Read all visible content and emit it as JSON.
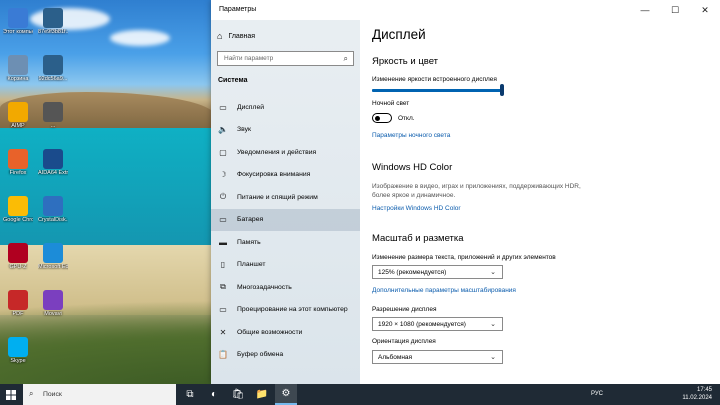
{
  "desktop": {
    "icons": [
      {
        "label": "Этот компьютер",
        "icon": "computer-icon",
        "color": "#3a7bd5"
      },
      {
        "label": "87e9f3b81f...",
        "icon": "image-file-icon",
        "color": "#2b5f8a"
      },
      {
        "label": "Корзина",
        "icon": "recycle-bin-icon",
        "color": "#6d8fb3"
      },
      {
        "label": "92dc56a9...",
        "icon": "image-file-icon",
        "color": "#2b5f8a"
      },
      {
        "label": "AIMP",
        "icon": "aimp-icon",
        "color": "#f2a900"
      },
      {
        "label": "...",
        "icon": "image-file-icon",
        "color": "#555"
      },
      {
        "label": "Firefox",
        "icon": "firefox-icon",
        "color": "#e8622a"
      },
      {
        "label": "AIDA64 Extreme",
        "icon": "aida64-icon",
        "color": "#1a4b8c"
      },
      {
        "label": "Google Chrome",
        "icon": "chrome-icon",
        "color": "#fbbc05"
      },
      {
        "label": "CrystalDisk...",
        "icon": "crystaldisk-icon",
        "color": "#2e6fbf"
      },
      {
        "label": "GPU-Z",
        "icon": "gpuz-icon",
        "color": "#b00020"
      },
      {
        "label": "Microsoft Edge",
        "icon": "edge-icon",
        "color": "#1c8cd8"
      },
      {
        "label": "PDF",
        "icon": "pdf-icon",
        "color": "#c62828"
      },
      {
        "label": "Movavi",
        "icon": "movavi-icon",
        "color": "#7b3fbf"
      },
      {
        "label": "Skype",
        "icon": "skype-icon",
        "color": "#00aff0"
      }
    ]
  },
  "window": {
    "title": "Параметры",
    "minimize": "—",
    "maximize": "☐",
    "close": "✕"
  },
  "sidebar": {
    "home": "Главная",
    "search_placeholder": "Найти параметр",
    "section": "Система",
    "items": [
      {
        "label": "Дисплей",
        "icon": "display-icon",
        "glyph": "▭"
      },
      {
        "label": "Звук",
        "icon": "speaker-icon",
        "glyph": "🔈"
      },
      {
        "label": "Уведомления и действия",
        "icon": "notification-icon",
        "glyph": "▢"
      },
      {
        "label": "Фокусировка внимания",
        "icon": "focus-moon-icon",
        "glyph": "☽"
      },
      {
        "label": "Питание и спящий режим",
        "icon": "power-icon",
        "glyph": "⏻"
      },
      {
        "label": "Батарея",
        "icon": "battery-icon",
        "glyph": "▭"
      },
      {
        "label": "Память",
        "icon": "storage-icon",
        "glyph": "▬"
      },
      {
        "label": "Планшет",
        "icon": "tablet-icon",
        "glyph": "▯"
      },
      {
        "label": "Многозадачность",
        "icon": "multitasking-icon",
        "glyph": "⧉"
      },
      {
        "label": "Проецирование на этот компьютер",
        "icon": "project-icon",
        "glyph": "▭"
      },
      {
        "label": "Общие возможности",
        "icon": "shared-experiences-icon",
        "glyph": "✕"
      },
      {
        "label": "Буфер обмена",
        "icon": "clipboard-icon",
        "glyph": "📋"
      }
    ]
  },
  "content": {
    "title": "Дисплей",
    "brightness_section": "Яркость и цвет",
    "brightness_label": "Изменение яркости встроенного дисплея",
    "brightness_value": 1.0,
    "night_light_label": "Ночной свет",
    "night_light_state": "Откл.",
    "night_light_link": "Параметры ночного света",
    "hd_section": "Windows HD Color",
    "hd_desc": "Изображение в видео, играх и приложениях, поддерживающих HDR, более яркое и динамичное.",
    "hd_link": "Настройки Windows HD Color",
    "scale_section": "Масштаб и разметка",
    "scale_label": "Изменение размера текста, приложений и других элементов",
    "scale_value": "125% (рекомендуется)",
    "scale_link": "Дополнительные параметры масштабирования",
    "resolution_label": "Разрешение дисплея",
    "resolution_value": "1920 × 1080 (рекомендуется)",
    "orientation_label": "Ориентация дисплея",
    "orientation_value": "Альбомная"
  },
  "taskbar": {
    "search_placeholder": "Поиск",
    "apps": [
      {
        "name": "task-view-icon",
        "glyph": "⧉"
      },
      {
        "name": "edge-icon",
        "glyph": "◐"
      },
      {
        "name": "store-icon",
        "glyph": "🛍"
      },
      {
        "name": "file-explorer-icon",
        "glyph": "📁"
      },
      {
        "name": "settings-icon",
        "glyph": "⚙"
      }
    ],
    "lang": "РУС",
    "time": "17:45",
    "date": "11.02.2024"
  },
  "colors": {
    "accent": "#0063b1",
    "link": "#0b5cad",
    "taskbar": "#1f2a35"
  }
}
